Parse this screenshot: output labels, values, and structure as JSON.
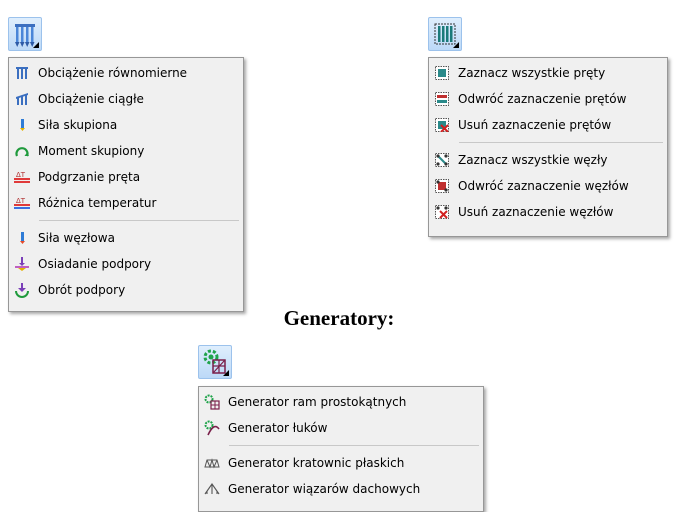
{
  "loads_menu": {
    "items": [
      {
        "icon": "uniform-load-icon",
        "label": "Obciążenie równomierne"
      },
      {
        "icon": "continuous-load-icon",
        "label": "Obciążenie ciągłe"
      },
      {
        "icon": "point-force-icon",
        "label": "Siła skupiona"
      },
      {
        "icon": "point-moment-icon",
        "label": "Moment skupiony"
      },
      {
        "icon": "bar-heating-icon",
        "label": "Podgrzanie pręta"
      },
      {
        "icon": "temperature-difference-icon",
        "label": "Różnica temperatur"
      },
      {
        "icon": "nodal-force-icon",
        "label": "Siła węzłowa"
      },
      {
        "icon": "support-settlement-icon",
        "label": "Osiadanie podpory"
      },
      {
        "icon": "support-rotation-icon",
        "label": "Obrót podpory"
      }
    ]
  },
  "selection_menu": {
    "items": [
      {
        "icon": "select-all-bars-icon",
        "label": "Zaznacz wszystkie pręty"
      },
      {
        "icon": "invert-bars-selection-icon",
        "label": "Odwróć zaznaczenie prętów"
      },
      {
        "icon": "clear-bars-selection-icon",
        "label": "Usuń zaznaczenie prętów"
      },
      {
        "icon": "select-all-nodes-icon",
        "label": "Zaznacz wszystkie węzły"
      },
      {
        "icon": "invert-nodes-selection-icon",
        "label": "Odwróć zaznaczenie węzłów"
      },
      {
        "icon": "clear-nodes-selection-icon",
        "label": "Usuń zaznaczenie węzłów"
      }
    ]
  },
  "generators": {
    "heading": "Generatory:",
    "items": [
      {
        "icon": "frame-generator-icon",
        "label": "Generator ram prostokątnych"
      },
      {
        "icon": "arch-generator-icon",
        "label": "Generator łuków"
      },
      {
        "icon": "truss-generator-icon",
        "label": "Generator kratownic płaskich"
      },
      {
        "icon": "roof-truss-generator-icon",
        "label": "Generator wiązarów dachowych"
      }
    ]
  }
}
